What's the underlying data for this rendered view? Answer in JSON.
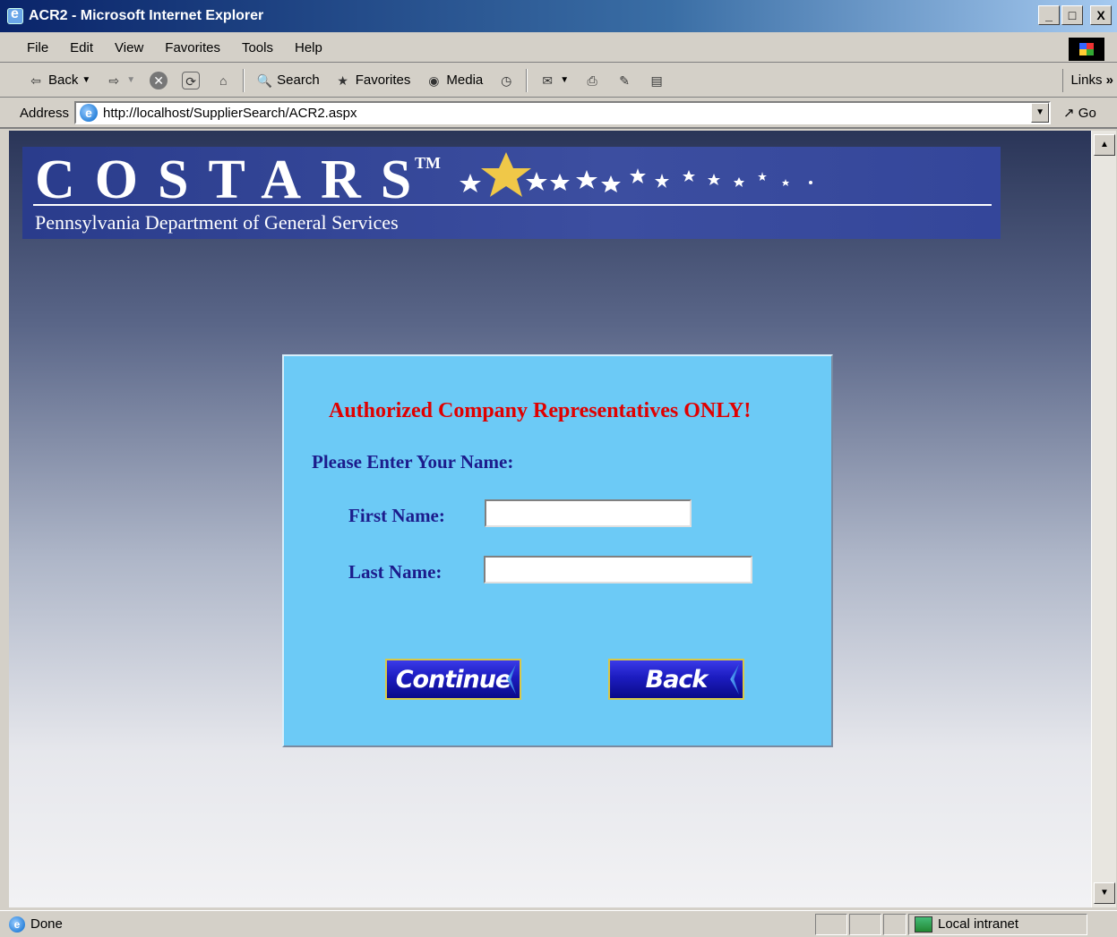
{
  "window": {
    "title": "ACR2 - Microsoft Internet Explorer",
    "buttons": {
      "minimize": "_",
      "maximize": "□",
      "close": "X"
    }
  },
  "menu": {
    "items": [
      {
        "label": "File"
      },
      {
        "label": "Edit"
      },
      {
        "label": "View"
      },
      {
        "label": "Favorites"
      },
      {
        "label": "Tools"
      },
      {
        "label": "Help"
      }
    ]
  },
  "toolbar": {
    "back_label": "Back",
    "search_label": "Search",
    "favorites_label": "Favorites",
    "media_label": "Media",
    "links_label": "Links"
  },
  "address": {
    "label": "Address",
    "url": "http://localhost/SupplierSearch/ACR2.aspx",
    "go_label": "Go"
  },
  "banner": {
    "title": "COSTARS",
    "trademark": "TM",
    "subtitle": "Pennsylvania Department of General Services"
  },
  "form": {
    "warning": "Authorized Company Representatives ONLY!",
    "prompt": "Please Enter Your Name:",
    "first_name_label": "First Name:",
    "first_name_value": "",
    "last_name_label": "Last Name:",
    "last_name_value": "",
    "continue_label": "Continue",
    "back_label": "Back"
  },
  "status": {
    "text": "Done",
    "zone": "Local intranet"
  }
}
